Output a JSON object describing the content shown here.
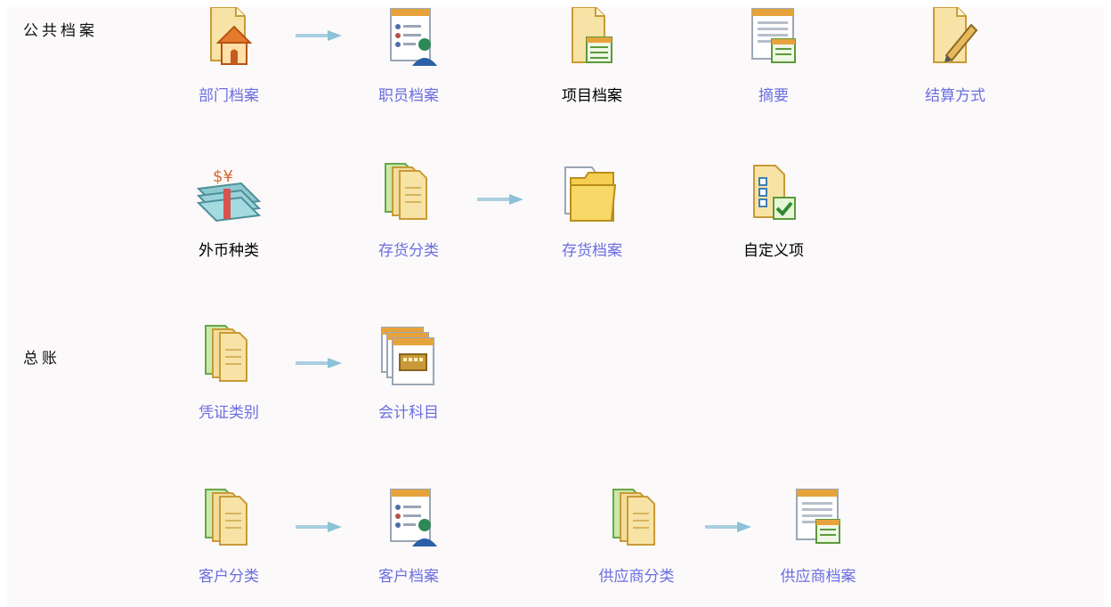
{
  "sections": {
    "public_archives": "公共档案",
    "general_ledger": "总账"
  },
  "items": {
    "department": {
      "label": "部门档案"
    },
    "staff": {
      "label": "职员档案"
    },
    "project": {
      "label": "项目档案"
    },
    "summary": {
      "label": "摘要"
    },
    "settlement": {
      "label": "结算方式"
    },
    "currency": {
      "label": "外币种类"
    },
    "inventory_class": {
      "label": "存货分类"
    },
    "inventory": {
      "label": "存货档案"
    },
    "custom_item": {
      "label": "自定义项"
    },
    "voucher_type": {
      "label": "凭证类别"
    },
    "account": {
      "label": "会计科目"
    },
    "customer_class": {
      "label": "客户分类"
    },
    "customer": {
      "label": "客户档案"
    },
    "supplier_class": {
      "label": "供应商分类"
    },
    "supplier": {
      "label": "供应商档案"
    }
  },
  "colors": {
    "link": "#6a6fe0",
    "plain": "#000000",
    "paper": "#f7e3a6",
    "paper_edge": "#c99a37",
    "green_paper": "#c9e9a9",
    "arrow": "#a9cfe0"
  }
}
